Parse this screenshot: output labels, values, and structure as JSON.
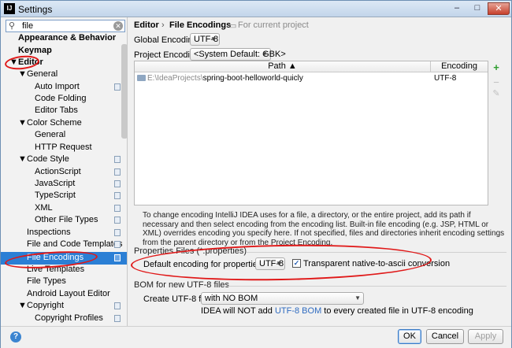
{
  "window": {
    "title": "Settings",
    "app_icon": "IJ",
    "minimize": "–",
    "maximize": "□",
    "close": "✕"
  },
  "search": {
    "value": "file",
    "icon": "search-icon"
  },
  "tree": {
    "items": [
      {
        "label": "Appearance & Behavior",
        "bold": true
      },
      {
        "label": "Keymap",
        "bold": true
      },
      {
        "label": "Editor",
        "bold": true
      },
      {
        "label": "General"
      },
      {
        "label": "Auto Import"
      },
      {
        "label": "Code Folding"
      },
      {
        "label": "Editor Tabs"
      },
      {
        "label": "Color Scheme"
      },
      {
        "label": "General"
      },
      {
        "label": "HTTP Request"
      },
      {
        "label": "Code Style"
      },
      {
        "label": "ActionScript"
      },
      {
        "label": "JavaScript"
      },
      {
        "label": "TypeScript"
      },
      {
        "label": "XML"
      },
      {
        "label": "Other File Types"
      },
      {
        "label": "Inspections"
      },
      {
        "label": "File and Code Templates"
      },
      {
        "label": "File Encodings"
      },
      {
        "label": "Live Templates"
      },
      {
        "label": "File Types"
      },
      {
        "label": "Android Layout Editor"
      },
      {
        "label": "Copyright"
      },
      {
        "label": "Copyright Profiles"
      }
    ]
  },
  "breadcrumb": {
    "root": "Editor",
    "sep": "›",
    "current": "File Encodings",
    "note": "For current project"
  },
  "global_encoding": {
    "label": "Global Encoding:",
    "value": "UTF-8"
  },
  "project_encoding": {
    "label": "Project Encoding:",
    "value": "<System Default: GBK>"
  },
  "table": {
    "columns": {
      "path": "Path ▲",
      "encoding": "Encoding"
    },
    "rows": [
      {
        "path_prefix": "E:\\IdeaProjects\\",
        "path_name": "spring-boot-helloworld-quicly",
        "encoding": "UTF-8"
      }
    ],
    "add": "+",
    "remove": "−",
    "edit": "✎"
  },
  "help_text": "To change encoding IntelliJ IDEA uses for a file, a directory, or the entire project, add its path if necessary and then select encoding from the encoding list. Built-in file encoding (e.g. JSP, HTML or XML) overrides encoding you specify here. If not specified, files and directories inherit encoding settings from the parent directory or from the Project Encoding.",
  "properties": {
    "section": "Properties Files (*.properties)",
    "label": "Default encoding for properties files:",
    "value": "UTF-8",
    "checkbox_label": "Transparent native-to-ascii conversion",
    "checked": true,
    "check_glyph": "✓"
  },
  "bom": {
    "section": "BOM for new UTF-8 files",
    "label": "Create UTF-8 files:",
    "value": "with NO BOM",
    "note_before": "IDEA will NOT add ",
    "note_link": "UTF-8 BOM",
    "note_after": " to every created file in UTF-8 encoding"
  },
  "buttons": {
    "help": "?",
    "ok": "OK",
    "cancel": "Cancel",
    "apply": "Apply"
  },
  "colors": {
    "selection": "#2b7fd5",
    "annotation": "#e01818",
    "link": "#2f6bc0"
  }
}
